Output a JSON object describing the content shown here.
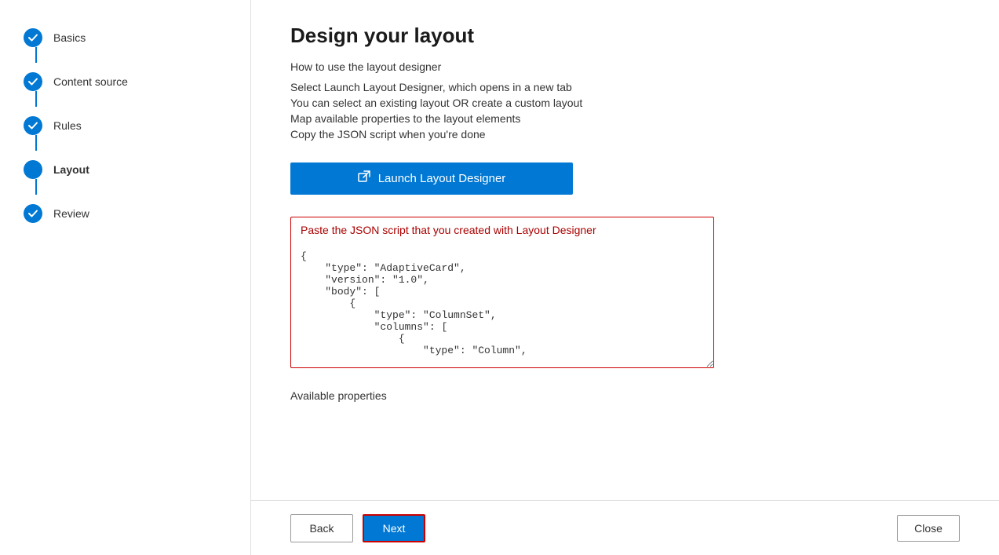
{
  "sidebar": {
    "items": [
      {
        "id": "basics",
        "label": "Basics",
        "state": "completed"
      },
      {
        "id": "content-source",
        "label": "Content source",
        "state": "completed"
      },
      {
        "id": "rules",
        "label": "Rules",
        "state": "completed"
      },
      {
        "id": "layout",
        "label": "Layout",
        "state": "active"
      },
      {
        "id": "review",
        "label": "Review",
        "state": "completed"
      }
    ]
  },
  "main": {
    "title": "Design your layout",
    "how_to_label": "How to use the layout designer",
    "instructions": [
      "Select Launch Layout Designer, which opens in a new tab",
      "You can select an existing layout OR create a custom layout",
      "Map available properties to the layout elements",
      "Copy the JSON script when you're done"
    ],
    "launch_button_label": "Launch Layout Designer",
    "json_placeholder": "Paste the JSON script that you created with Layout Designer",
    "json_content": "{\n    \"type\": \"AdaptiveCard\",\n    \"version\": \"1.0\",\n    \"body\": [\n        {\n            \"type\": \"ColumnSet\",\n            \"columns\": [\n                {\n                    \"type\": \"Column\",",
    "available_properties_label": "Available properties"
  },
  "footer": {
    "back_label": "Back",
    "next_label": "Next",
    "close_label": "Close"
  },
  "icons": {
    "checkmark": "✓",
    "launch_external": "⬒",
    "active_dot": "●"
  },
  "colors": {
    "blue": "#0078d4",
    "red_border": "#c00",
    "completed_icon": "#0078d4"
  }
}
